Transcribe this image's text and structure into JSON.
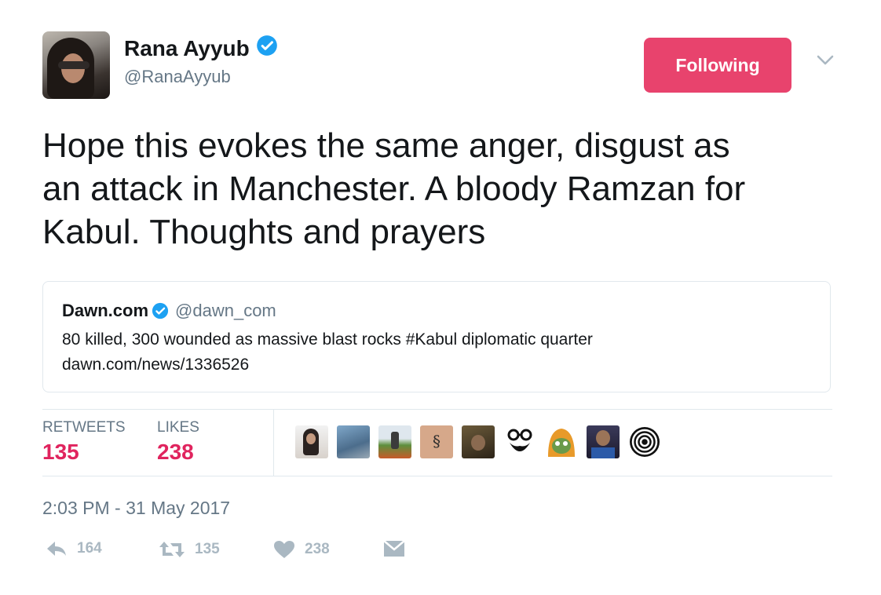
{
  "author": {
    "name": "Rana Ayyub",
    "handle": "@RanaAyyub",
    "verified": true
  },
  "follow_button": {
    "label": "Following",
    "color": "#e8436d"
  },
  "tweet": {
    "lines": [
      "Hope this evokes the same anger, disgust as",
      "an attack in Manchester. A bloody Ramzan for",
      "Kabul. Thoughts and prayers"
    ]
  },
  "quoted_tweet": {
    "name": "Dawn.com",
    "handle": "@dawn_com",
    "verified": true,
    "text_line1": "80 killed, 300 wounded as massive blast rocks #Kabul diplomatic quarter",
    "text_line2": "dawn.com/news/1336526"
  },
  "stats": {
    "retweets_label": "RETWEETS",
    "retweets_value": "135",
    "likes_label": "LIKES",
    "likes_value": "238"
  },
  "likers": [
    "avatar-1",
    "avatar-2",
    "avatar-3",
    "avatar-4",
    "avatar-5",
    "avatar-6",
    "avatar-7",
    "avatar-8",
    "avatar-9"
  ],
  "timestamp": "2:03 PM - 31 May 2017",
  "actions": {
    "reply_count": "164",
    "retweet_count": "135",
    "like_count": "238"
  },
  "colors": {
    "accent": "#e0245e",
    "verified": "#1da1f2",
    "muted": "#657786",
    "icon": "#aab8c2"
  }
}
